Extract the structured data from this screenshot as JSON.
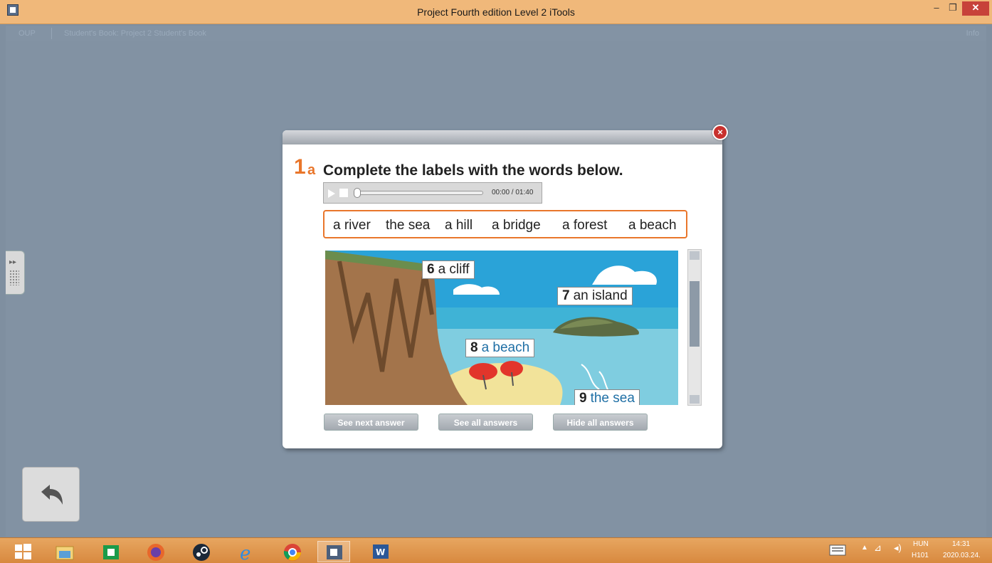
{
  "window": {
    "title": "Project Fourth edition Level 2 iTools",
    "min": "–",
    "restore": "❐",
    "close": "✕"
  },
  "subnav": {
    "oup": "OUP",
    "breadcrumb": "Student's Book: Project 2 Student's Book",
    "info": "Info"
  },
  "exercise": {
    "number": "1",
    "letter": "a",
    "instruction": "Complete the labels with the words below.",
    "audio": {
      "time": "00:00 / 01:40",
      "progress": 0
    },
    "word_bank": [
      "a river",
      "the sea",
      "a hill",
      "a bridge",
      "a forest",
      "a beach"
    ],
    "labels": [
      {
        "num": "6",
        "text": "a cliff",
        "answered": false
      },
      {
        "num": "7",
        "text": "an island",
        "answered": false
      },
      {
        "num": "8",
        "text": "a beach",
        "answered": true
      },
      {
        "num": "9",
        "text": "the sea",
        "answered": true
      }
    ],
    "buttons": {
      "next": "See next answer",
      "all": "See all answers",
      "hide": "Hide all answers"
    }
  },
  "tray": {
    "lang": "HUN",
    "layout": "H101",
    "time": "14:31",
    "date": "2020.03.24."
  },
  "colors": {
    "accent_orange": "#e9762b",
    "answer_blue": "#1f6fa5",
    "taskbar": "#dc8f45"
  }
}
